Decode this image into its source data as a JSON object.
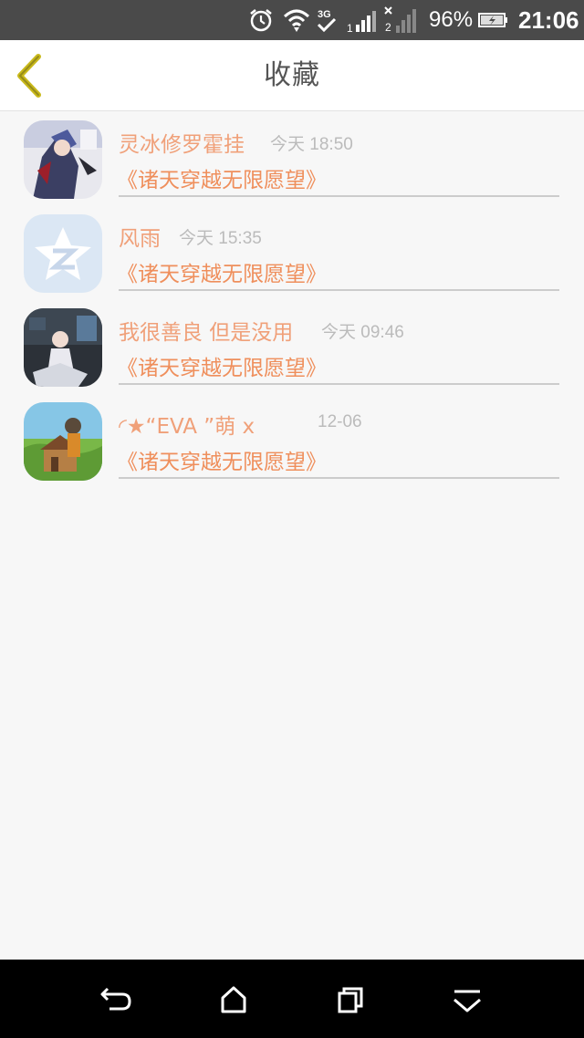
{
  "status_bar": {
    "battery_percent": "96%",
    "time": "21:06",
    "network_type": "3G",
    "icons": [
      "alarm-icon",
      "wifi-icon",
      "3g-icon",
      "signal-icon-1",
      "signal-icon-2",
      "battery-icon"
    ]
  },
  "header": {
    "title": "收藏",
    "back_icon": "chevron-left-icon"
  },
  "colors": {
    "accent_name": "#f0a079",
    "accent_book": "#ef8f5c",
    "time_gray": "#bbbbbb",
    "back_chevron": "#c9b91b"
  },
  "favorites": [
    {
      "name": "灵冰修罗霍挂",
      "time": "今天 18:50",
      "book": "《诸天穿越无限愿望》",
      "avatar": "anime-avatar"
    },
    {
      "name": "风雨",
      "time": "今天 15:35",
      "book": "《诸天穿越无限愿望》",
      "avatar": "qq-default-avatar"
    },
    {
      "name": "我很善良 但是没用",
      "time": "今天 09:46",
      "book": "《诸天穿越无限愿望》",
      "avatar": "anime-avatar"
    },
    {
      "name": "◜★“EVA ”萌 x",
      "time": "12-06",
      "book": "《诸天穿越无限愿望》",
      "avatar": "game-avatar"
    }
  ],
  "nav_bar": {
    "icons": [
      "back-arrow-icon",
      "home-icon",
      "recent-apps-icon",
      "menu-down-icon"
    ]
  }
}
